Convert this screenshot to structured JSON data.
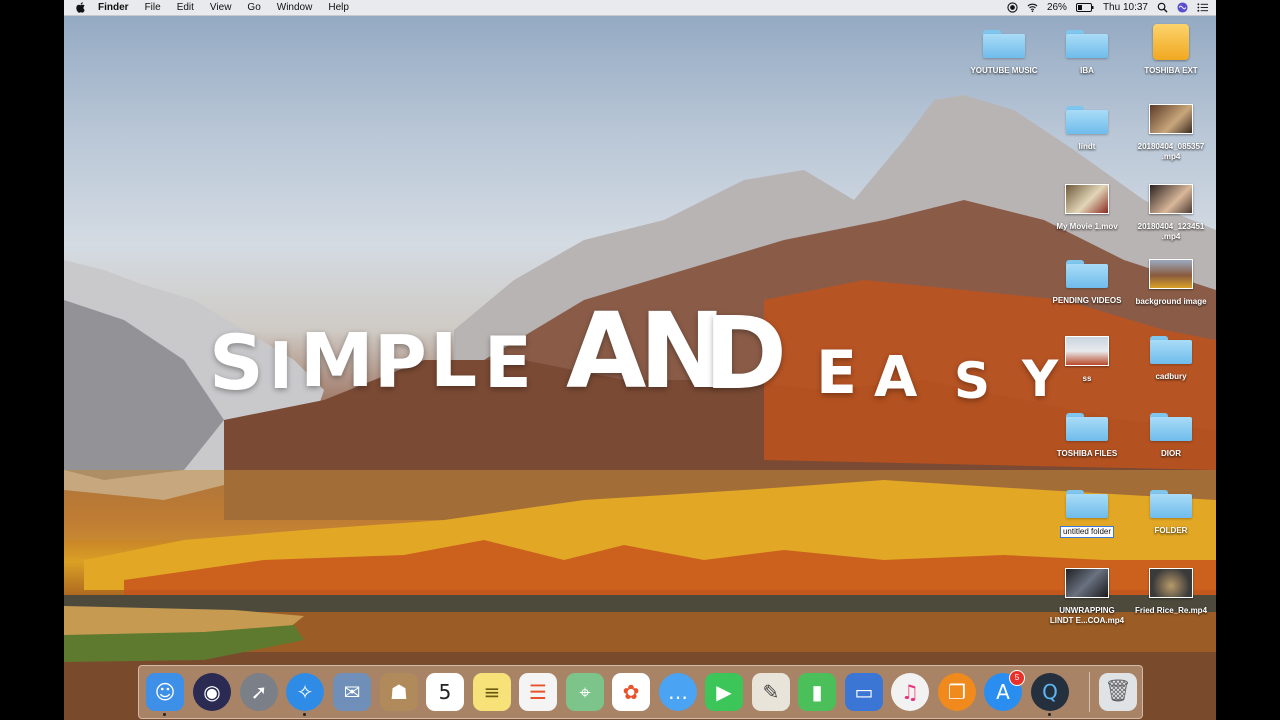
{
  "menubar": {
    "app_name": "Finder",
    "menus": [
      "File",
      "Edit",
      "View",
      "Go",
      "Window",
      "Help"
    ],
    "battery": "26%",
    "clock": "Thu 10:37"
  },
  "overlay": {
    "words": [
      "S",
      "I",
      "M",
      "P",
      "L",
      "E",
      "A",
      "N",
      "D",
      "E",
      "A",
      "S",
      "Y"
    ]
  },
  "desktop_icons": [
    {
      "label": "YOUTUBE MUSIC",
      "kind": "folder"
    },
    {
      "label": "IBA",
      "kind": "folder"
    },
    {
      "label": "TOSHIBA EXT",
      "kind": "drive"
    },
    {
      "label": "lindt",
      "kind": "folder"
    },
    {
      "label": "20180404_085357 .mp4",
      "kind": "video"
    },
    {
      "label": "My Movie 1.mov",
      "kind": "video"
    },
    {
      "label": "20180404_123451 .mp4",
      "kind": "video"
    },
    {
      "label": "PENDING VIDEOS",
      "kind": "folder"
    },
    {
      "label": "background image",
      "kind": "image"
    },
    {
      "label": "ss",
      "kind": "image"
    },
    {
      "label": "cadbury",
      "kind": "folder"
    },
    {
      "label": "TOSHIBA FILES",
      "kind": "folder"
    },
    {
      "label": "DIOR",
      "kind": "folder"
    },
    {
      "label": "untitled folder",
      "kind": "folder"
    },
    {
      "label": "FOLDER",
      "kind": "folder"
    },
    {
      "label": "UNWRAPPING LINDT E...COA.mp4",
      "kind": "video"
    },
    {
      "label": "Fried Rice_Re.mp4",
      "kind": "video"
    }
  ],
  "dock": {
    "apps": [
      {
        "name": "finder-icon",
        "color": "#3d8fe8",
        "glyph": "☺"
      },
      {
        "name": "siri-icon",
        "color": "#2a2a52",
        "glyph": "◉"
      },
      {
        "name": "launchpad-icon",
        "color": "#7a7f88",
        "glyph": "➚"
      },
      {
        "name": "safari-icon",
        "color": "#2f8ce6",
        "glyph": "✧"
      },
      {
        "name": "mail-stamp-icon",
        "color": "#6f8fb8",
        "glyph": "✉"
      },
      {
        "name": "contacts-icon",
        "color": "#b08a5a",
        "glyph": "☗"
      },
      {
        "name": "calendar-icon",
        "color": "#ffffff",
        "glyph": "5"
      },
      {
        "name": "notes-icon",
        "color": "#f7e27a",
        "glyph": "≡"
      },
      {
        "name": "reminders-icon",
        "color": "#f4f4f4",
        "glyph": "☰"
      },
      {
        "name": "maps-icon",
        "color": "#7cc48a",
        "glyph": "⌖"
      },
      {
        "name": "photos-icon",
        "color": "#ffffff",
        "glyph": "✿"
      },
      {
        "name": "messages-icon",
        "color": "#4aa3f3",
        "glyph": "…"
      },
      {
        "name": "facetime-icon",
        "color": "#3cc65a",
        "glyph": "▶"
      },
      {
        "name": "preview-icon",
        "color": "#e9e4da",
        "glyph": "✎"
      },
      {
        "name": "numbers-icon",
        "color": "#4bbf5a",
        "glyph": "▮"
      },
      {
        "name": "keynote-icon",
        "color": "#3b76d4",
        "glyph": "▭"
      },
      {
        "name": "itunes-icon",
        "color": "#f2f2f2",
        "glyph": "♫"
      },
      {
        "name": "ibooks-icon",
        "color": "#f08a1c",
        "glyph": "❐"
      },
      {
        "name": "app-store-icon",
        "color": "#2a8ef0",
        "glyph": "A",
        "badge": "5"
      },
      {
        "name": "quicktime-icon",
        "color": "#25303e",
        "glyph": "Q"
      },
      {
        "name": "trash-icon",
        "color": "#dfe3e6",
        "glyph": "🗑"
      }
    ]
  }
}
